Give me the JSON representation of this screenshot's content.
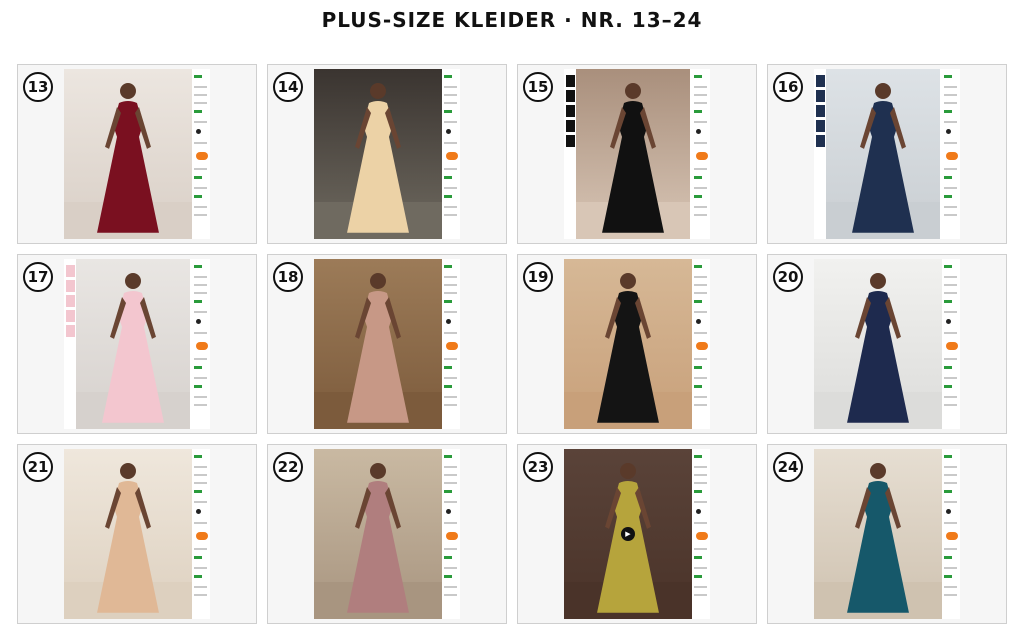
{
  "title": "PLUS-SIZE KLEIDER · NR. 13–24",
  "cards": [
    {
      "number": "13",
      "dress_color": "#7a1020",
      "bg_top": "#ece6e0",
      "bg_bottom": "#d9cfc6",
      "thumbs": false,
      "play": false
    },
    {
      "number": "14",
      "dress_color": "#ecd2a6",
      "bg_top": "#3a3430",
      "bg_bottom": "#6f6a60",
      "thumbs": false,
      "play": false
    },
    {
      "number": "15",
      "dress_color": "#111111",
      "bg_top": "#a98f7c",
      "bg_bottom": "#d8c6b6",
      "thumbs": true,
      "play": false
    },
    {
      "number": "16",
      "dress_color": "#1f3050",
      "bg_top": "#dde2e6",
      "bg_bottom": "#c9ced2",
      "thumbs": true,
      "play": false
    },
    {
      "number": "17",
      "dress_color": "#f3c6cf",
      "bg_top": "#e9e6e3",
      "bg_bottom": "#d6d1cd",
      "thumbs": true,
      "play": false
    },
    {
      "number": "18",
      "dress_color": "#c79886",
      "bg_top": "#9c7b58",
      "bg_bottom": "#7c5b3c",
      "thumbs": false,
      "play": false
    },
    {
      "number": "19",
      "dress_color": "#141414",
      "bg_top": "#d6b896",
      "bg_bottom": "#c8a07a",
      "thumbs": false,
      "play": false
    },
    {
      "number": "20",
      "dress_color": "#1e2a4e",
      "bg_top": "#f1f1ef",
      "bg_bottom": "#dcdcda",
      "thumbs": false,
      "play": false
    },
    {
      "number": "21",
      "dress_color": "#e0b896",
      "bg_top": "#efe7dc",
      "bg_bottom": "#ddd0bf",
      "thumbs": false,
      "play": false
    },
    {
      "number": "22",
      "dress_color": "#b07e7e",
      "bg_top": "#c9b9a2",
      "bg_bottom": "#a89580",
      "thumbs": false,
      "play": false
    },
    {
      "number": "23",
      "dress_color": "#b6a43c",
      "bg_top": "#5a4339",
      "bg_bottom": "#4a3329",
      "thumbs": false,
      "play": true
    },
    {
      "number": "24",
      "dress_color": "#16586a",
      "bg_top": "#e6ded2",
      "bg_bottom": "#cfc2b0",
      "thumbs": false,
      "play": false
    }
  ],
  "icons": {
    "play": "play-icon"
  },
  "accent_colors": {
    "cta_orange": "#f07a1a",
    "stock_green": "#2a9b3b"
  }
}
